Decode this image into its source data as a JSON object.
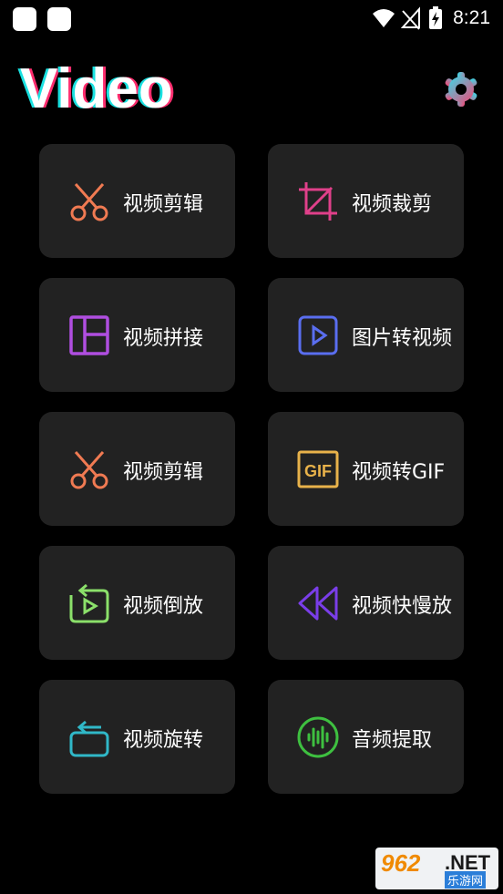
{
  "status_bar": {
    "time": "8:21",
    "icons": [
      "wifi-icon",
      "signal-off-icon",
      "battery-charging-icon"
    ]
  },
  "header": {
    "title": "Video",
    "settings_icon": "gear-icon"
  },
  "tools": [
    {
      "label": "视频剪辑",
      "icon": "scissors-icon",
      "color": "#f07a52"
    },
    {
      "label": "视频裁剪",
      "icon": "crop-icon",
      "color": "#e0408a"
    },
    {
      "label": "视频拼接",
      "icon": "layout-icon",
      "color": "#b04ee0"
    },
    {
      "label": "图片转视频",
      "icon": "play-square-icon",
      "color": "#5a6ef0"
    },
    {
      "label": "视频剪辑",
      "icon": "scissors-icon",
      "color": "#f07a52"
    },
    {
      "label": "视频转GIF",
      "icon": "gif-icon",
      "color": "#e8b24a"
    },
    {
      "label": "视频倒放",
      "icon": "replay-icon",
      "color": "#8be06a"
    },
    {
      "label": "视频快慢放",
      "icon": "rewind-icon",
      "color": "#7a3ee8"
    },
    {
      "label": "视频旋转",
      "icon": "rotate-icon",
      "color": "#30b8c8"
    },
    {
      "label": "音频提取",
      "icon": "audio-wave-icon",
      "color": "#3ec040"
    }
  ],
  "watermark": {
    "brand": "962",
    "suffix": ".NET",
    "sub": "乐游网"
  }
}
